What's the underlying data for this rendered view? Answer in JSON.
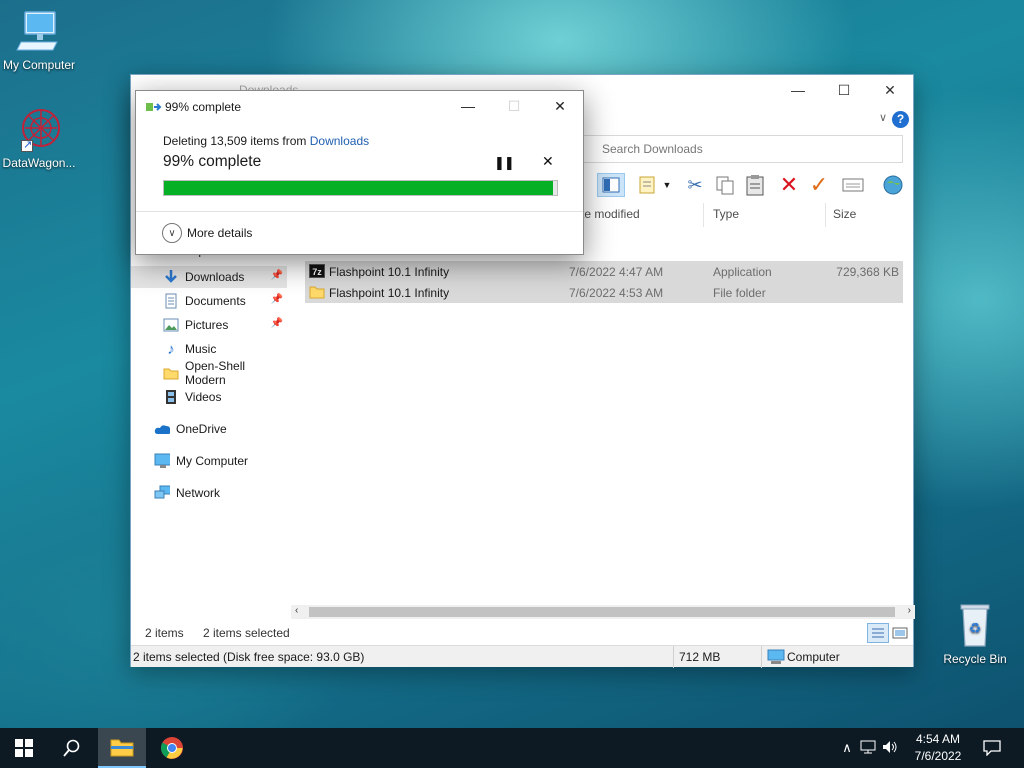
{
  "desktop": {
    "icons": [
      {
        "label": "My Computer"
      },
      {
        "label": "DataWagon..."
      },
      {
        "label": "Recycle Bin"
      }
    ]
  },
  "explorer": {
    "title": "Downloads",
    "search_placeholder": "Search Downloads",
    "columns": {
      "date": "te modified",
      "type": "Type",
      "size": "Size"
    },
    "nav": [
      {
        "label": "Desktop",
        "pinned": true
      },
      {
        "label": "Downloads",
        "pinned": true,
        "selected": true
      },
      {
        "label": "Documents",
        "pinned": true
      },
      {
        "label": "Pictures",
        "pinned": true
      },
      {
        "label": "Music"
      },
      {
        "label": "Open-Shell Modern"
      },
      {
        "label": "Videos"
      },
      {
        "label": "OneDrive"
      },
      {
        "label": "My Computer"
      },
      {
        "label": "Network"
      }
    ],
    "files": [
      {
        "name": "Flashpoint 10.1 Infinity",
        "date": "7/6/2022 4:47 AM",
        "type": "Application",
        "size": "729,368 KB",
        "icon": "7zip-archive-icon"
      },
      {
        "name": "Flashpoint 10.1 Infinity",
        "date": "7/6/2022 4:53 AM",
        "type": "File folder",
        "size": "",
        "icon": "folder-icon"
      }
    ],
    "status": {
      "item_count": "2 items",
      "selected_count": "2 items selected",
      "detail": "2 items selected (Disk free space: 93.0 GB)",
      "size": "712 MB",
      "location": "Computer"
    }
  },
  "dialog": {
    "title": "99% complete",
    "deleting_prefix": "Deleting 13,509 items from",
    "deleting_link": "Downloads",
    "progress_text": "99% complete",
    "progress": 0.99,
    "more_details": "More details"
  },
  "taskbar": {
    "time": "4:54 AM",
    "date": "7/6/2022"
  },
  "colors": {
    "progress_fill": "#06b025",
    "accent": "#1f6fd1",
    "taskbar": "#0d1a24"
  }
}
